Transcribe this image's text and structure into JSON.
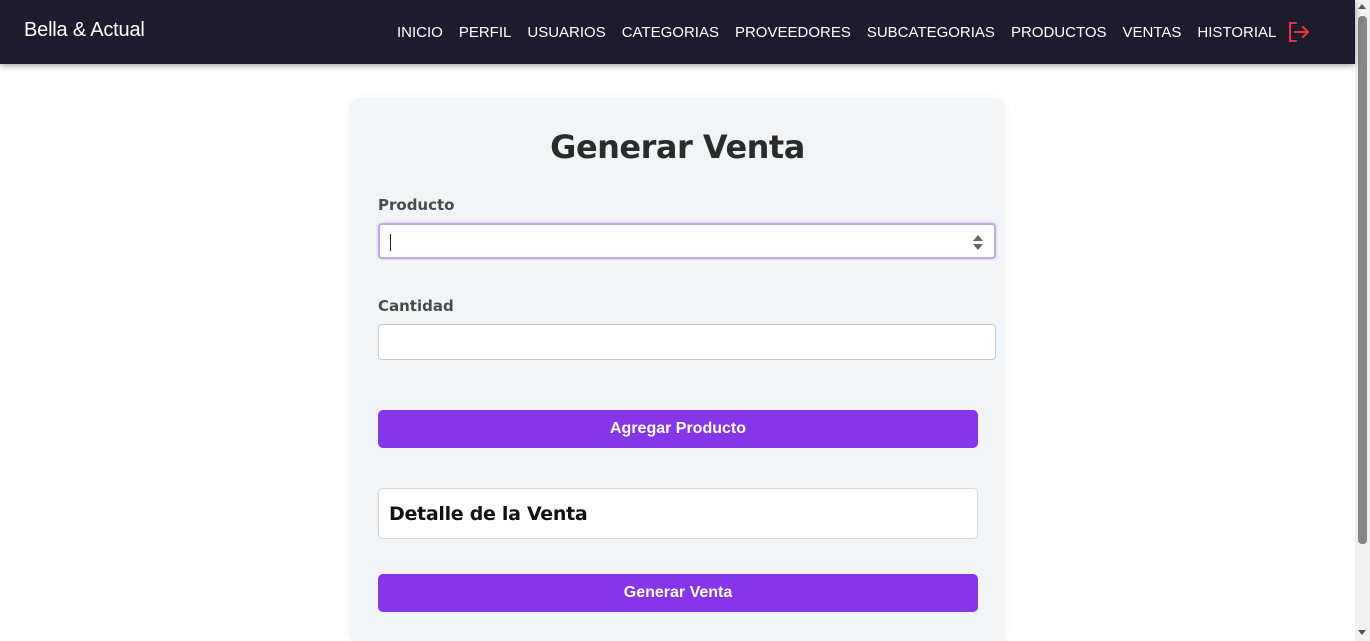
{
  "app": {
    "brand": "Bella & Actual"
  },
  "navbar": {
    "links": [
      {
        "label": "INICIO"
      },
      {
        "label": "PERFIL"
      },
      {
        "label": "USUARIOS"
      },
      {
        "label": "CATEGORIAS"
      },
      {
        "label": "PROVEEDORES"
      },
      {
        "label": "SUBCATEGORIAS"
      },
      {
        "label": "PRODUCTOS"
      },
      {
        "label": "VENTAS"
      },
      {
        "label": "HISTORIAL"
      }
    ],
    "logout_icon": "logout-icon"
  },
  "form": {
    "title": "Generar Venta",
    "producto": {
      "label": "Producto",
      "value": "",
      "placeholder": ""
    },
    "cantidad": {
      "label": "Cantidad",
      "value": "",
      "placeholder": ""
    },
    "add_button_label": "Agregar Producto",
    "detail_title": "Detalle de la Venta",
    "submit_button_label": "Generar Venta"
  },
  "colors": {
    "navbar_bg": "#1f1b2e",
    "accent": "#8436e8",
    "logout_icon": "#e8323c",
    "card_bg": "#f2f5f7"
  }
}
